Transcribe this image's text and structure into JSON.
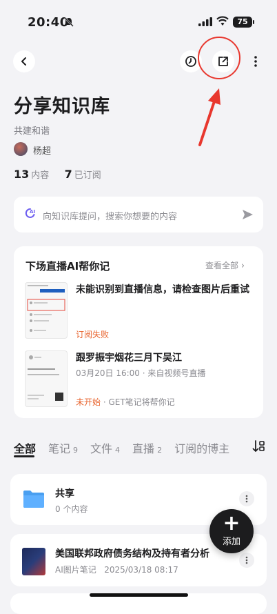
{
  "status_bar": {
    "time": "20:40",
    "battery": "75"
  },
  "header": {
    "title": "分享知识库",
    "subtitle": "共建和谐",
    "author": "杨超"
  },
  "stats": {
    "content_count": "13",
    "content_label": "内容",
    "subscribe_count": "7",
    "subscribe_label": "已订阅"
  },
  "ask": {
    "placeholder": "向知识库提问，搜索你想要的内容"
  },
  "live_section": {
    "title": "下场直播AI帮你记",
    "see_all": "查看全部",
    "items": [
      {
        "title": "未能识别到直播信息，请检查图片后重试",
        "status": "订阅失败"
      },
      {
        "title": "跟罗振宇烟花三月下吴江",
        "meta": "03月20日 16:00 · 来自视频号直播",
        "status": "未开始",
        "status_suffix": " · GET笔记将帮你记"
      }
    ]
  },
  "tabs": [
    {
      "label": "全部",
      "count": ""
    },
    {
      "label": "笔记",
      "count": "9"
    },
    {
      "label": "文件",
      "count": "4"
    },
    {
      "label": "直播",
      "count": "2"
    },
    {
      "label": "订阅的博主",
      "count": ""
    }
  ],
  "list": [
    {
      "title": "共享",
      "meta": "0 个内容"
    },
    {
      "title": "美国联邦政府债务结构及持有者分析",
      "meta": "AI图片笔记   2025/03/18 08:17"
    }
  ],
  "fab": {
    "label": "添加"
  },
  "colors": {
    "accent_warn": "#e8632d",
    "annotation": "#e8372e",
    "ai_purple": "#6b5cf0"
  }
}
